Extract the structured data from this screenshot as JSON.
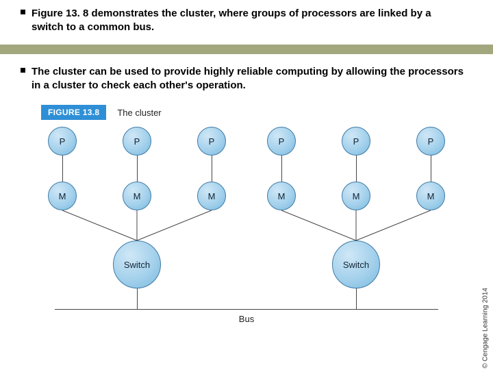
{
  "bullets": {
    "b1_pre": "Figure 13. 8 demonstrates the ",
    "b1_kw": "cluster",
    "b1_mid": ", where ",
    "b1_kw2": "groups of processors are linked by a switch to a common bus.",
    "b2_pre": "The cluster can be used to ",
    "b2_kw": "provide highly reliable computing by allowing the processors in a cluster to check each other's operation."
  },
  "figure": {
    "tag": "FIGURE 13.8",
    "title": "The cluster",
    "node_p": "P",
    "node_m": "M",
    "switch": "Switch",
    "bus": "Bus"
  },
  "diagram": {
    "clusters": 2,
    "processors_per_cluster": 3,
    "memories_per_cluster": 3,
    "switch_per_cluster": 1,
    "shared_bus": true
  },
  "copyright": "© Cengage Learning 2014"
}
